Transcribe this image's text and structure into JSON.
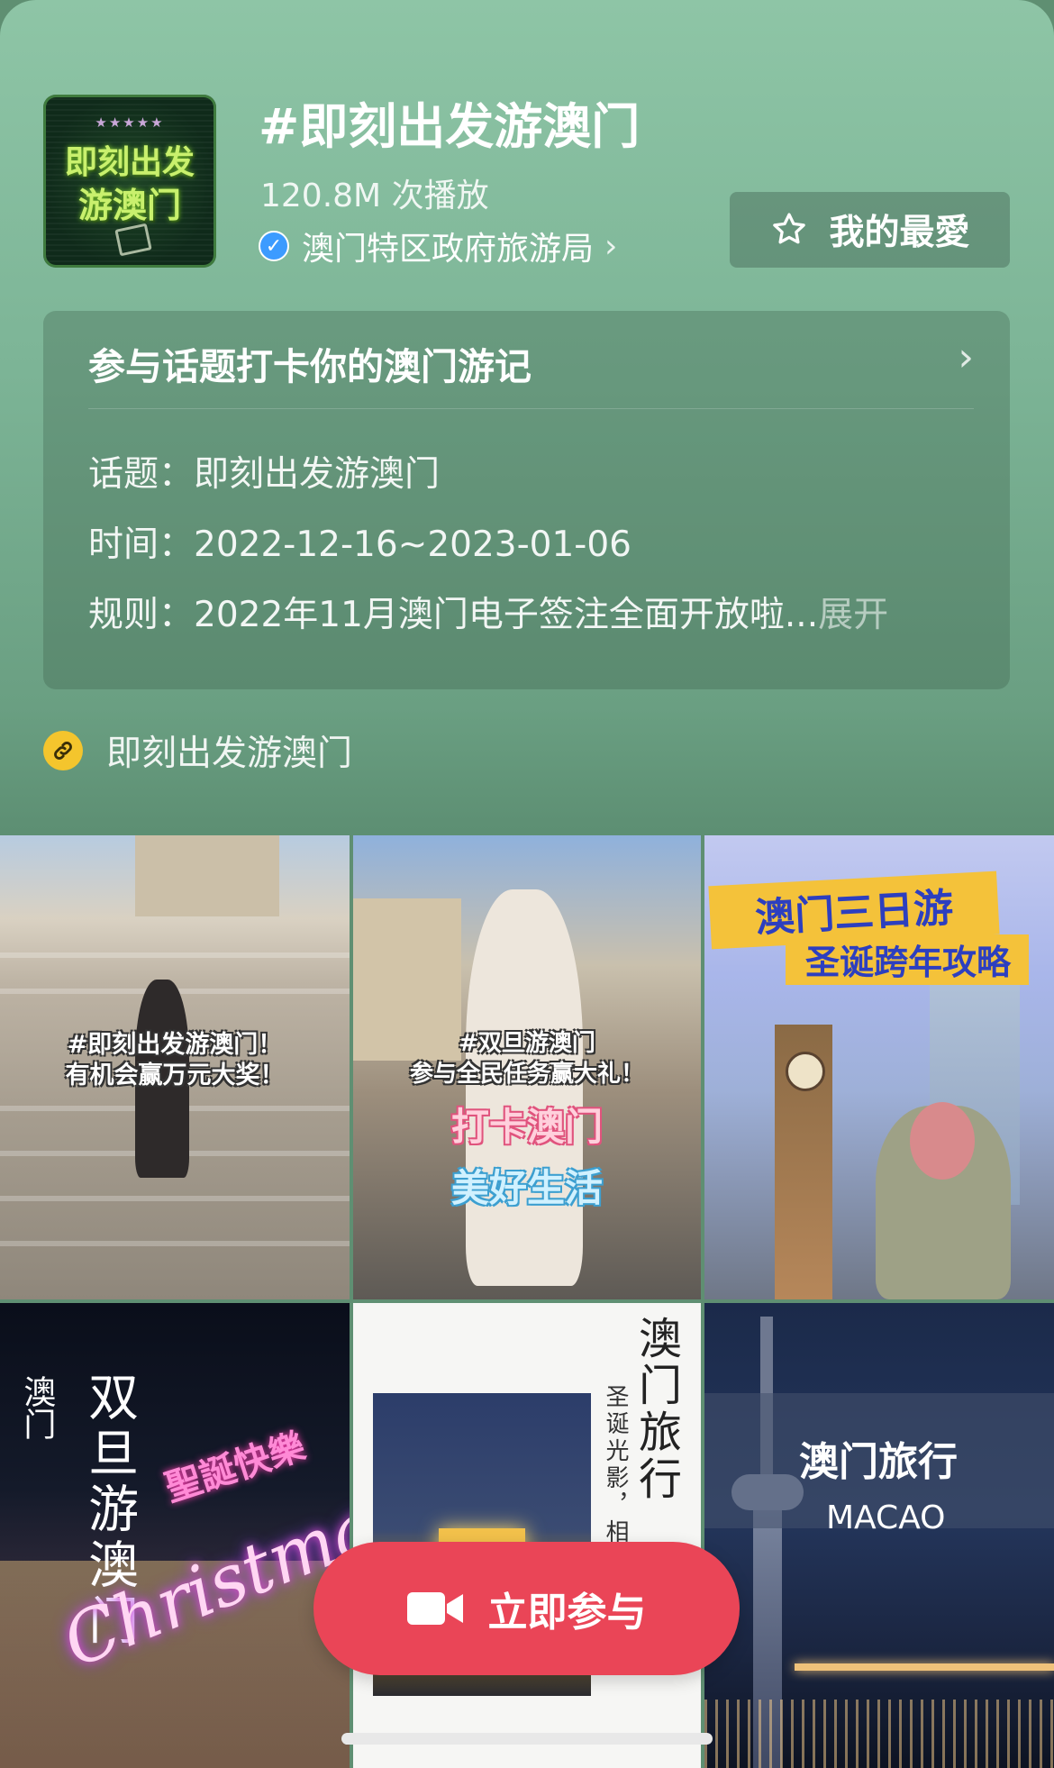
{
  "colors": {
    "accent": "#ea4557",
    "verified": "#3c9bff",
    "link_icon": "#f4c52d",
    "header_green": "#7db597"
  },
  "header": {
    "cover_text_line1": "即刻出发",
    "cover_text_line2": "游澳门",
    "title": "#即刻出发游澳门",
    "plays": "120.8M 次播放",
    "publisher": "澳门特区政府旅游局",
    "favorite_label": "我的最愛"
  },
  "topic_card": {
    "heading": "参与话题打卡你的澳门游记",
    "rows": [
      {
        "label": "话题：",
        "value": "即刻出发游澳门"
      },
      {
        "label": "时间：",
        "value": "2022-12-16~2023-01-06"
      },
      {
        "label": "规则：",
        "value": "2022年11月澳门电子签注全面开放啦...",
        "more": "展开"
      }
    ]
  },
  "link": {
    "icon": "link-icon",
    "label": "即刻出发游澳门"
  },
  "videos": [
    {
      "caption_lines": [
        "#即刻出发游澳门！",
        "有机会赢万元大奖！"
      ]
    },
    {
      "caption_lines": [
        "#双旦游澳门",
        "参与全民任务赢大礼！",
        "打卡澳门",
        "美好生活"
      ]
    },
    {
      "caption_lines": [
        "澳门三日游",
        "圣诞跨年攻略"
      ]
    },
    {
      "caption_lines": [
        "澳门",
        "双旦游澳门",
        "聖誕快樂",
        "Christmas"
      ]
    },
    {
      "caption_lines": [
        "澳门旅行",
        "圣诞光影，相"
      ]
    },
    {
      "caption_lines": [
        "澳门旅行",
        "MACAO"
      ]
    }
  ],
  "cta": {
    "label": "立即参与",
    "icon": "video-camera-icon"
  }
}
